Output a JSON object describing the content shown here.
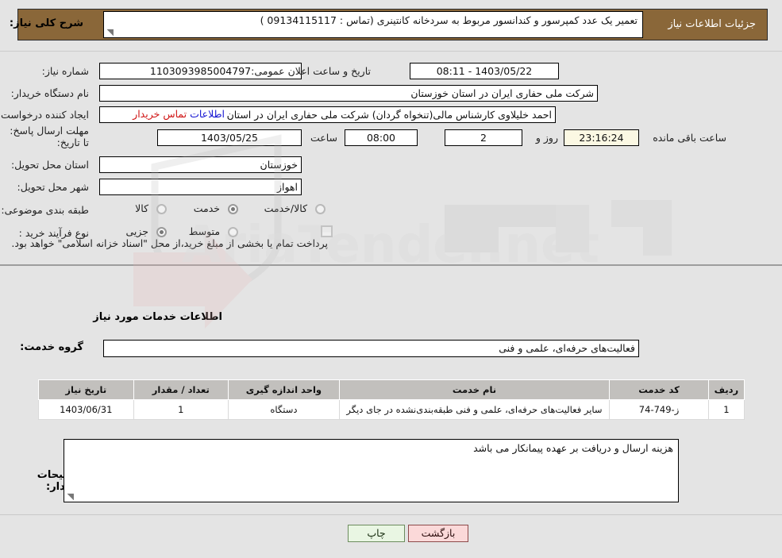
{
  "header": {
    "title": "جزئیات اطلاعات نیاز"
  },
  "info": {
    "need_number_label": "شماره نیاز:",
    "need_number_value": "1103093985004797",
    "announce_label": "تاریخ و ساعت اعلان عمومی:",
    "announce_value": "1403/05/22 - 08:11",
    "buyer_org_label": "نام دستگاه خریدار:",
    "buyer_org_value": "شرکت ملی حفاری ایران در استان خوزستان",
    "creator_label": "ایجاد کننده درخواست:",
    "creator_value": "احمد خلیلاوی کارشناس مالی(تنخواه گردان) شرکت ملی حفاری ایران در استان",
    "contact_link_part1": "اطلاعات",
    "contact_link_part2": "تماس خریدار",
    "deadline_label": "مهلت ارسال پاسخ: تا تاریخ:",
    "deadline_date": "1403/05/25",
    "deadline_hour_label": "ساعت",
    "deadline_time": "08:00",
    "remaining_days": "2",
    "days_and_label": "روز و",
    "remaining_time": "23:16:24",
    "remaining_suffix": "ساعت باقی مانده",
    "province_label": "استان محل تحویل:",
    "province_value": "خوزستان",
    "city_label": "شهر محل تحویل:",
    "city_value": "اهواز",
    "classify_label": "طبقه بندی موضوعی:",
    "classify_options": [
      {
        "label": "کالا",
        "selected": false
      },
      {
        "label": "خدمت",
        "selected": true
      },
      {
        "label": "کالا/خدمت",
        "selected": false
      }
    ],
    "process_label": "نوع فرآیند خرید :",
    "process_options": [
      {
        "label": "جزیی",
        "selected": true
      },
      {
        "label": "متوسط",
        "selected": false
      }
    ],
    "treasury_checkbox_label": "پرداخت تمام یا بخشی از مبلغ خرید،از محل \"اسناد خزانه اسلامی\" خواهد بود.",
    "treasury_checked": false
  },
  "description": {
    "label": "شرح کلی نیاز:",
    "value": "تعمیر یک عدد کمپرسور و کندانسور مربوط به سردخانه کانتینری  (تماس : 09134115117 )"
  },
  "services": {
    "section_title": "اطلاعات خدمات مورد نیاز",
    "group_label": "گروه خدمت:",
    "group_value": "فعالیت‌های حرفه‌ای، علمی و فنی",
    "columns": [
      "ردیف",
      "کد خدمت",
      "نام خدمت",
      "واحد اندازه گیری",
      "تعداد / مقدار",
      "تاریخ نیاز"
    ],
    "rows": [
      {
        "index": "1",
        "code": "ز-749-74",
        "name": "سایر فعالیت‌های حرفه‌ای، علمی و فنی طبقه‌بندی‌نشده در جای دیگر",
        "unit": "دستگاه",
        "quantity": "1",
        "need_date": "1403/06/31"
      }
    ]
  },
  "notes": {
    "label": "توضیحات خریدار:",
    "value": "هزینه ارسال و دریافت بر عهده پیمانکار می باشد"
  },
  "footer": {
    "print_label": "چاپ",
    "back_label": "بازگشت"
  },
  "watermark": {
    "text": "AriaTender.net"
  },
  "colors": {
    "header_bg": "#8a6739",
    "page_bg": "#e4e4e4",
    "link_blue": "#1414d2",
    "link_red": "#d01414",
    "print_btn": "#e9f6e3",
    "back_btn": "#fbd9d9"
  }
}
